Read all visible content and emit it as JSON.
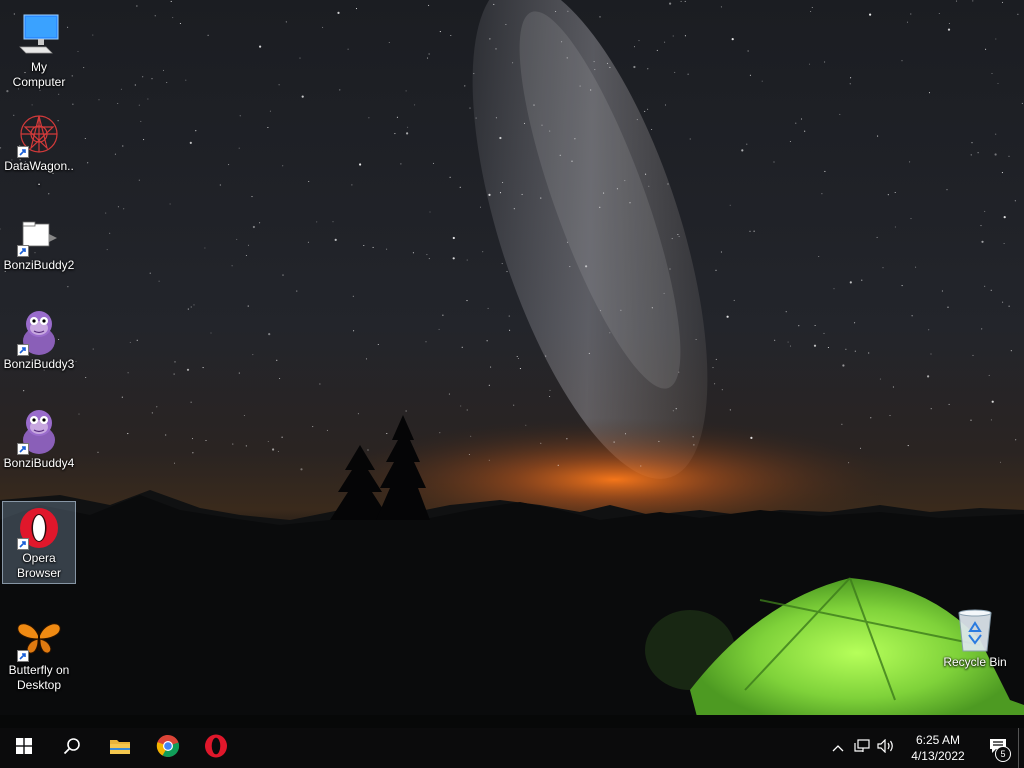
{
  "desktop": {
    "icons": [
      {
        "label": "My Computer",
        "icon": "computer-icon"
      },
      {
        "label": "DataWagon...",
        "icon": "datawagon-icon"
      },
      {
        "label": "BonziBuddy2",
        "icon": "bonzibuddy2-icon"
      },
      {
        "label": "BonziBuddy3",
        "icon": "bonzibuddy-gorilla-icon"
      },
      {
        "label": "BonziBuddy4",
        "icon": "bonzibuddy-gorilla-icon"
      },
      {
        "label": "Opera Browser",
        "icon": "opera-icon"
      },
      {
        "label": "Butterfly on Desktop",
        "icon": "butterfly-icon"
      }
    ],
    "recycle_bin": {
      "label": "Recycle Bin",
      "icon": "recycle-bin-icon"
    }
  },
  "taskbar": {
    "pinned": [
      "start-icon",
      "search-icon",
      "file-explorer-icon",
      "chrome-icon",
      "opera-icon"
    ],
    "tray": {
      "time": "6:25 AM",
      "date": "4/13/2022",
      "notification_count": "5"
    }
  },
  "colors": {
    "taskbar": "#0b0b0c",
    "tent": "#8fe04a",
    "horizon_glow": "#e07a1f",
    "windows_blue": "#2d8cff",
    "opera_red": "#e0172b"
  }
}
